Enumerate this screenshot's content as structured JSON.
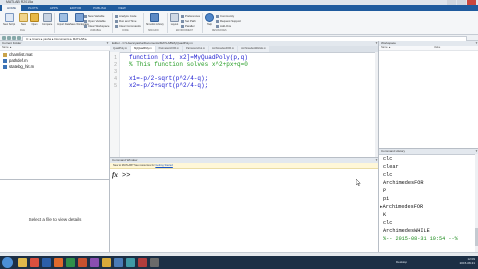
{
  "window": {
    "title": "MATLAB R2015a"
  },
  "ribbon": {
    "tabs": [
      "HOME",
      "PLOTS",
      "APPS",
      "EDITOR",
      "PUBLISH",
      "VIEW"
    ],
    "active_tab": "HOME",
    "buttons": [
      {
        "label": "New Script",
        "icon": "new-script-icon"
      },
      {
        "label": "New",
        "icon": "new-icon"
      },
      {
        "label": "Open",
        "icon": "open-folder-icon"
      },
      {
        "label": "Compare",
        "icon": "compare-icon"
      },
      {
        "label": "Import Data",
        "icon": "import-data-icon"
      },
      {
        "label": "Save Workspace",
        "icon": "save-workspace-icon"
      }
    ],
    "variable_items": [
      "New Variable",
      "Open Variable",
      "Clear Workspace"
    ],
    "code_items": [
      "Analyze Code",
      "Run and Time",
      "Clear Commands"
    ],
    "sim_buttons": [
      {
        "label": "Simulink Library",
        "icon": "simulink-icon"
      },
      {
        "label": "Layout",
        "icon": "layout-icon"
      }
    ],
    "env_items": [
      "Preferences",
      "Set Path",
      "Parallel"
    ],
    "resource_items": [
      "Community",
      "Request Support",
      "Add-Ons"
    ],
    "help_button": {
      "label": "Help",
      "icon": "help-icon"
    },
    "groups": [
      "FILE",
      "VARIABLE",
      "CODE",
      "SIMULINK",
      "ENVIRONMENT",
      "RESOURCES"
    ],
    "accent": "#1f5b9e"
  },
  "address": {
    "path": "C: ▸ Users ▸ yasha ▸ Documents ▸ MATLAB ▸"
  },
  "current_folder": {
    "title": "Current Folder",
    "column": "Name ▲",
    "files": [
      {
        "name": "chamlist.mat",
        "type": "mat"
      },
      {
        "name": "pathdef.m",
        "type": "m"
      },
      {
        "name": "statebg_hit.m",
        "type": "m"
      }
    ],
    "details_message": "Select a file to view details"
  },
  "editor": {
    "title": "Editor - C:\\Users\\yasha\\Documents\\MATLAB\\MyQuadPoly.m",
    "tabs": [
      "QuadPoly.m",
      "MyQuadPoly.m",
      "ParmetersFOR.m",
      "ParmetersOut.m",
      "ArchimedesFOR.m",
      "ArchimedesWHILE.m"
    ],
    "active_tab": 1,
    "line_numbers": [
      "1",
      "2",
      "3",
      "4",
      "5"
    ],
    "lines": [
      "function [x1, x2]=MyQuadPoly(p,q)",
      "% This function solves x^2+px+q=0",
      "",
      "x1=-p/2-sqrt(p^2/4-q);",
      "x2=-p/2+sqrt(p^2/4-q);"
    ],
    "colors": {
      "keyword": "#1b1bd0",
      "comment": "#239b23"
    }
  },
  "command_window": {
    "title": "Command Window",
    "hint_text": "New to MATLAB? See resources for",
    "hint_link": "Getting Started",
    "fx": "fx",
    "prompt": ">>"
  },
  "workspace": {
    "title": "Workspace",
    "columns": [
      "Name ▲",
      "Value"
    ]
  },
  "command_history": {
    "title": "Command History",
    "lines": [
      {
        "mark": "",
        "text": "clc",
        "section": false
      },
      {
        "mark": "",
        "text": "clear",
        "section": false
      },
      {
        "mark": "",
        "text": "clc",
        "section": false
      },
      {
        "mark": "",
        "text": "ArchimedesFOR",
        "section": false
      },
      {
        "mark": "",
        "text": "P",
        "section": false
      },
      {
        "mark": "",
        "text": "pi",
        "section": false
      },
      {
        "mark": "▸",
        "text": "ArchimedesFOR",
        "section": false
      },
      {
        "mark": "",
        "text": "K",
        "section": false
      },
      {
        "mark": "",
        "text": "clc",
        "section": false
      },
      {
        "mark": "",
        "text": "ArchimedesWHILE",
        "section": false
      },
      {
        "mark": "",
        "text": "%-- 2015-08-31 10:54 --%",
        "section": true
      }
    ]
  },
  "taskbar": {
    "desktop_label": "Desktop",
    "time": "12:09",
    "date": "2015-08-31",
    "apps": [
      "explorer-icon",
      "chrome-icon",
      "word-icon",
      "matlab-icon",
      "excel-icon",
      "powerpoint-icon",
      "media-icon",
      "folder-icon",
      "app-icon",
      "app-icon",
      "app-icon",
      "app-icon"
    ]
  }
}
